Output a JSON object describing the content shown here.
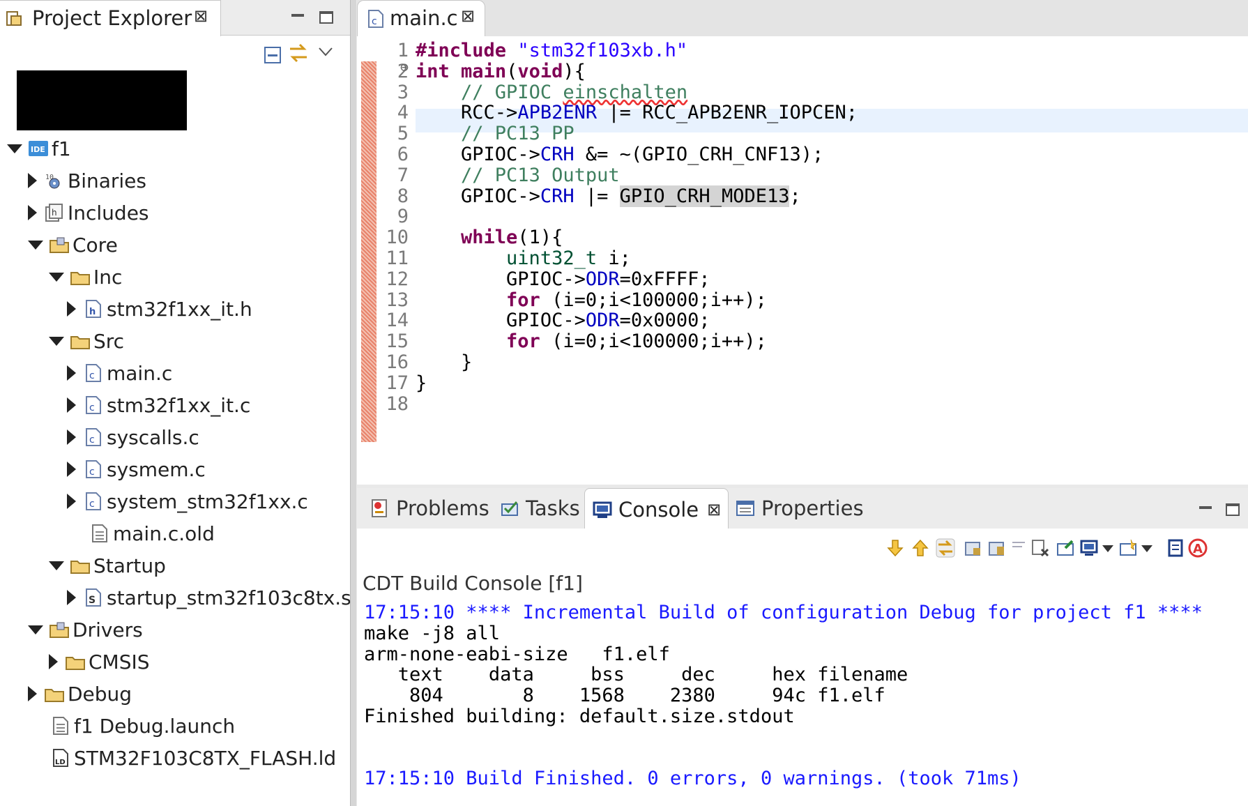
{
  "explorer": {
    "title": "Project Explorer",
    "close_glyph": "⊠",
    "tree": [
      {
        "label": "f1",
        "icon": "ide-project-icon",
        "state": "open",
        "depth": 0
      },
      {
        "label": "Binaries",
        "icon": "binaries-icon",
        "state": "closed",
        "depth": 1
      },
      {
        "label": "Includes",
        "icon": "includes-icon",
        "state": "closed",
        "depth": 1
      },
      {
        "label": "Core",
        "icon": "source-folder-icon",
        "state": "open",
        "depth": 1
      },
      {
        "label": "Inc",
        "icon": "folder-icon",
        "state": "open",
        "depth": 2
      },
      {
        "label": "stm32f1xx_it.h",
        "icon": "header-file-icon",
        "state": "closed",
        "depth": 3
      },
      {
        "label": "Src",
        "icon": "folder-icon",
        "state": "open",
        "depth": 2
      },
      {
        "label": "main.c",
        "icon": "c-file-icon",
        "state": "closed",
        "depth": 3
      },
      {
        "label": "stm32f1xx_it.c",
        "icon": "c-file-icon",
        "state": "closed",
        "depth": 3
      },
      {
        "label": "syscalls.c",
        "icon": "c-file-icon",
        "state": "closed",
        "depth": 3
      },
      {
        "label": "sysmem.c",
        "icon": "c-file-icon",
        "state": "closed",
        "depth": 3
      },
      {
        "label": "system_stm32f1xx.c",
        "icon": "c-file-icon",
        "state": "closed",
        "depth": 3
      },
      {
        "label": "main.c.old",
        "icon": "text-file-icon",
        "state": "none",
        "depth": 3
      },
      {
        "label": "Startup",
        "icon": "folder-icon",
        "state": "open",
        "depth": 2
      },
      {
        "label": "startup_stm32f103c8tx.s",
        "icon": "asm-file-icon",
        "state": "closed",
        "depth": 3
      },
      {
        "label": "Drivers",
        "icon": "source-folder-icon",
        "state": "open",
        "depth": 1
      },
      {
        "label": "CMSIS",
        "icon": "folder-icon",
        "state": "closed",
        "depth": 2
      },
      {
        "label": "Debug",
        "icon": "folder-icon",
        "state": "closed",
        "depth": 1
      },
      {
        "label": "f1 Debug.launch",
        "icon": "text-file-icon",
        "state": "none",
        "depth": 1
      },
      {
        "label": "STM32F103C8TX_FLASH.ld",
        "icon": "linker-file-icon",
        "state": "none",
        "depth": 1
      }
    ]
  },
  "editor": {
    "tab_label": "main.c",
    "close_glyph": "⊠",
    "line_numbers": [
      "1",
      "2",
      "3",
      "4",
      "5",
      "6",
      "7",
      "8",
      "9",
      "10",
      "11",
      "12",
      "13",
      "14",
      "15",
      "16",
      "17",
      "18"
    ],
    "fold_marker": "⊖",
    "code": {
      "l1_kw": "#include",
      "l1_str": "\"stm32f103xb.h\"",
      "l2_kw1": "int",
      "l2_fn": "main",
      "l2_p1": "(",
      "l2_kw2": "void",
      "l2_p2": "){",
      "l3_cmt": "// GPIOC ",
      "l3_cmt2": "einschalten",
      "l4_a": "RCC->",
      "l4_f": "APB2ENR",
      "l4_b": " |= RCC_APB2ENR_IOPCEN;",
      "l5_cmt": "// PC13 PP",
      "l6_a": "GPIOC->",
      "l6_f": "CRH",
      "l6_b": " &= ~(GPIO_CRH_CNF13);",
      "l7_cmt": "// PC13 Output",
      "l8_a": "GPIOC->",
      "l8_f": "CRH",
      "l8_b": " |= ",
      "l8_sel": "GPIO_CRH_MODE13",
      "l8_c": ";",
      "l10_kw": "while",
      "l10_b": "(1){",
      "l11_t": "uint32_t",
      "l11_b": " i;",
      "l12_a": "GPIOC->",
      "l12_f": "ODR",
      "l12_b": "=0xFFFF;",
      "l13_kw": "for",
      "l13_b": " (i=0;i<100000;i++);",
      "l14_a": "GPIOC->",
      "l14_f": "ODR",
      "l14_b": "=0x0000;",
      "l15_kw": "for",
      "l15_b": " (i=0;i<100000;i++);",
      "l16": "}",
      "l17": "}"
    }
  },
  "console_view": {
    "tabs": [
      {
        "label": "Problems",
        "icon": "problems-icon"
      },
      {
        "label": "Tasks",
        "icon": "tasks-icon"
      },
      {
        "label": "Console",
        "icon": "console-icon",
        "active": true
      },
      {
        "label": "Properties",
        "icon": "properties-icon"
      }
    ],
    "close_glyph": "⊠",
    "console_title": "CDT Build Console [f1]",
    "lines": [
      {
        "text": "17:15:10 **** Incremental Build of configuration Debug for project f1 ****",
        "color": "#1a1aff"
      },
      {
        "text": "make -j8 all",
        "color": "#000000"
      },
      {
        "text": "arm-none-eabi-size   f1.elf",
        "color": "#000000"
      },
      {
        "text": "   text\t   data\t    bss\t    dec\t    hex\tfilename",
        "color": "#000000"
      },
      {
        "text": "    804\t      8\t   1568\t   2380\t    94c\tf1.elf",
        "color": "#000000"
      },
      {
        "text": "Finished building: default.size.stdout",
        "color": "#000000"
      },
      {
        "text": "",
        "color": "#000000"
      },
      {
        "text": "",
        "color": "#000000"
      },
      {
        "text": "17:15:10 Build Finished. 0 errors, 0 warnings. (took 71ms)",
        "color": "#1a1aff"
      }
    ]
  }
}
